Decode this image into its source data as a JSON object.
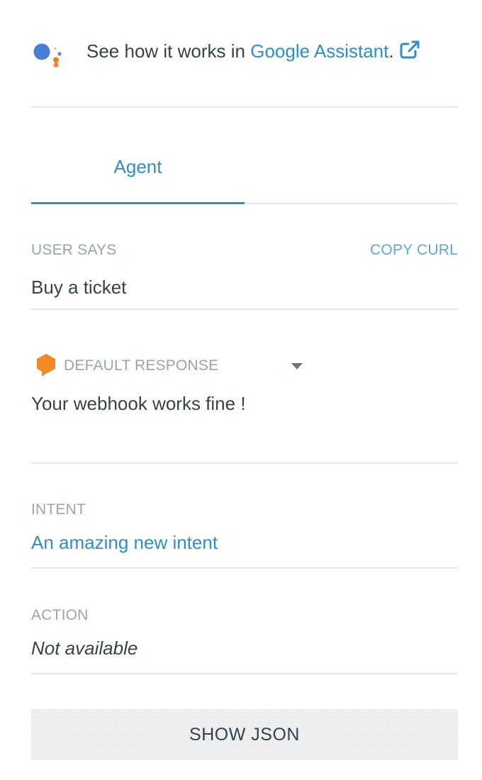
{
  "assistant": {
    "prefix": "See how it works in ",
    "link_label": "Google Assistant",
    "suffix": ".",
    "logo_icon": "google-assistant-logo",
    "external_icon": "external-link-icon"
  },
  "tabs": [
    {
      "label": "Agent",
      "active": true
    }
  ],
  "user_says": {
    "label": "USER SAYS",
    "value": "Buy a ticket",
    "copy_curl_label": "COPY CURL"
  },
  "default_response": {
    "label": "DEFAULT RESPONSE",
    "value": "Your webhook works fine !",
    "icon": "response-bubble-icon"
  },
  "intent": {
    "label": "INTENT",
    "value": "An amazing new intent"
  },
  "action": {
    "label": "ACTION",
    "value": "Not available"
  },
  "show_json_label": "SHOW JSON",
  "colors": {
    "accent": "#2d8ec8",
    "text": "#37424a",
    "muted": "#9aa3aa",
    "response_icon": "#f08a24",
    "assistant_blue": "#4285f4",
    "assistant_orange": "#f4822a"
  }
}
